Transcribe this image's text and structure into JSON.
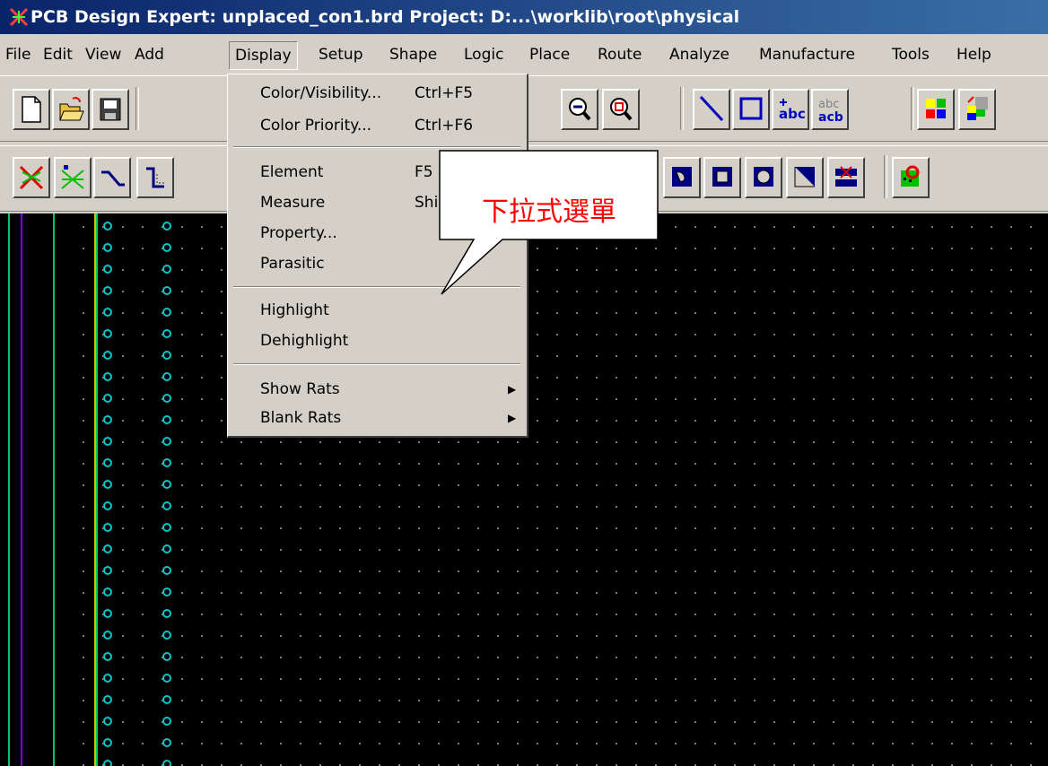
{
  "window": {
    "title": "PCB Design Expert: unplaced_con1.brd  Project: D:...\\worklib\\root\\physical",
    "app_icon": "pcb-app-icon"
  },
  "menubar": {
    "items": [
      "File",
      "Edit",
      "View",
      "Add",
      "Display",
      "Setup",
      "Shape",
      "Logic",
      "Place",
      "Route",
      "Analyze",
      "Manufacture",
      "Tools",
      "Help"
    ],
    "active": "Display"
  },
  "dropdown": {
    "groups": [
      [
        {
          "label": "Color/Visibility...",
          "shortcut": "Ctrl+F5"
        },
        {
          "label": "Color Priority...",
          "shortcut": "Ctrl+F6"
        }
      ],
      [
        {
          "label": "Element",
          "shortcut": "F5"
        },
        {
          "label": "Measure",
          "shortcut": "Shi"
        },
        {
          "label": "Property...",
          "shortcut": ""
        },
        {
          "label": "Parasitic",
          "shortcut": ""
        }
      ],
      [
        {
          "label": "Highlight",
          "shortcut": ""
        },
        {
          "label": "Dehighlight",
          "shortcut": ""
        }
      ],
      [
        {
          "label": "Show Rats",
          "shortcut": "",
          "submenu": true
        },
        {
          "label": "Blank Rats",
          "shortcut": "",
          "submenu": true
        }
      ]
    ]
  },
  "callout": {
    "text": "下拉式選單",
    "color": "#ff0000"
  },
  "toolbar1": {
    "icons": [
      "new-file-icon",
      "open-folder-icon",
      "save-icon",
      "zoom-in-icon",
      "zoom-out-icon",
      "zoom-fit-icon",
      "line-icon",
      "rectangle-icon",
      "add-text-icon",
      "change-text-icon",
      "color-visibility-icon",
      "color-priority-icon"
    ]
  },
  "toolbar2": {
    "icons": [
      "unroute-icon",
      "ratsnest-icon",
      "connect-icon",
      "slide-icon",
      "shape-icon",
      "void-shape-icon",
      "rect-shape-icon",
      "circle-shape-icon",
      "fill-shape-icon",
      "delete-shape-icon",
      "drc-icon"
    ]
  },
  "colors": {
    "canvas_background": "#000000",
    "grid_dot": "#808080",
    "pin_color": "#00c8c8",
    "board_outline_green": "#00c864",
    "board_outline_purple": "#8000ff",
    "board_outline_yellow": "#c8c800"
  }
}
